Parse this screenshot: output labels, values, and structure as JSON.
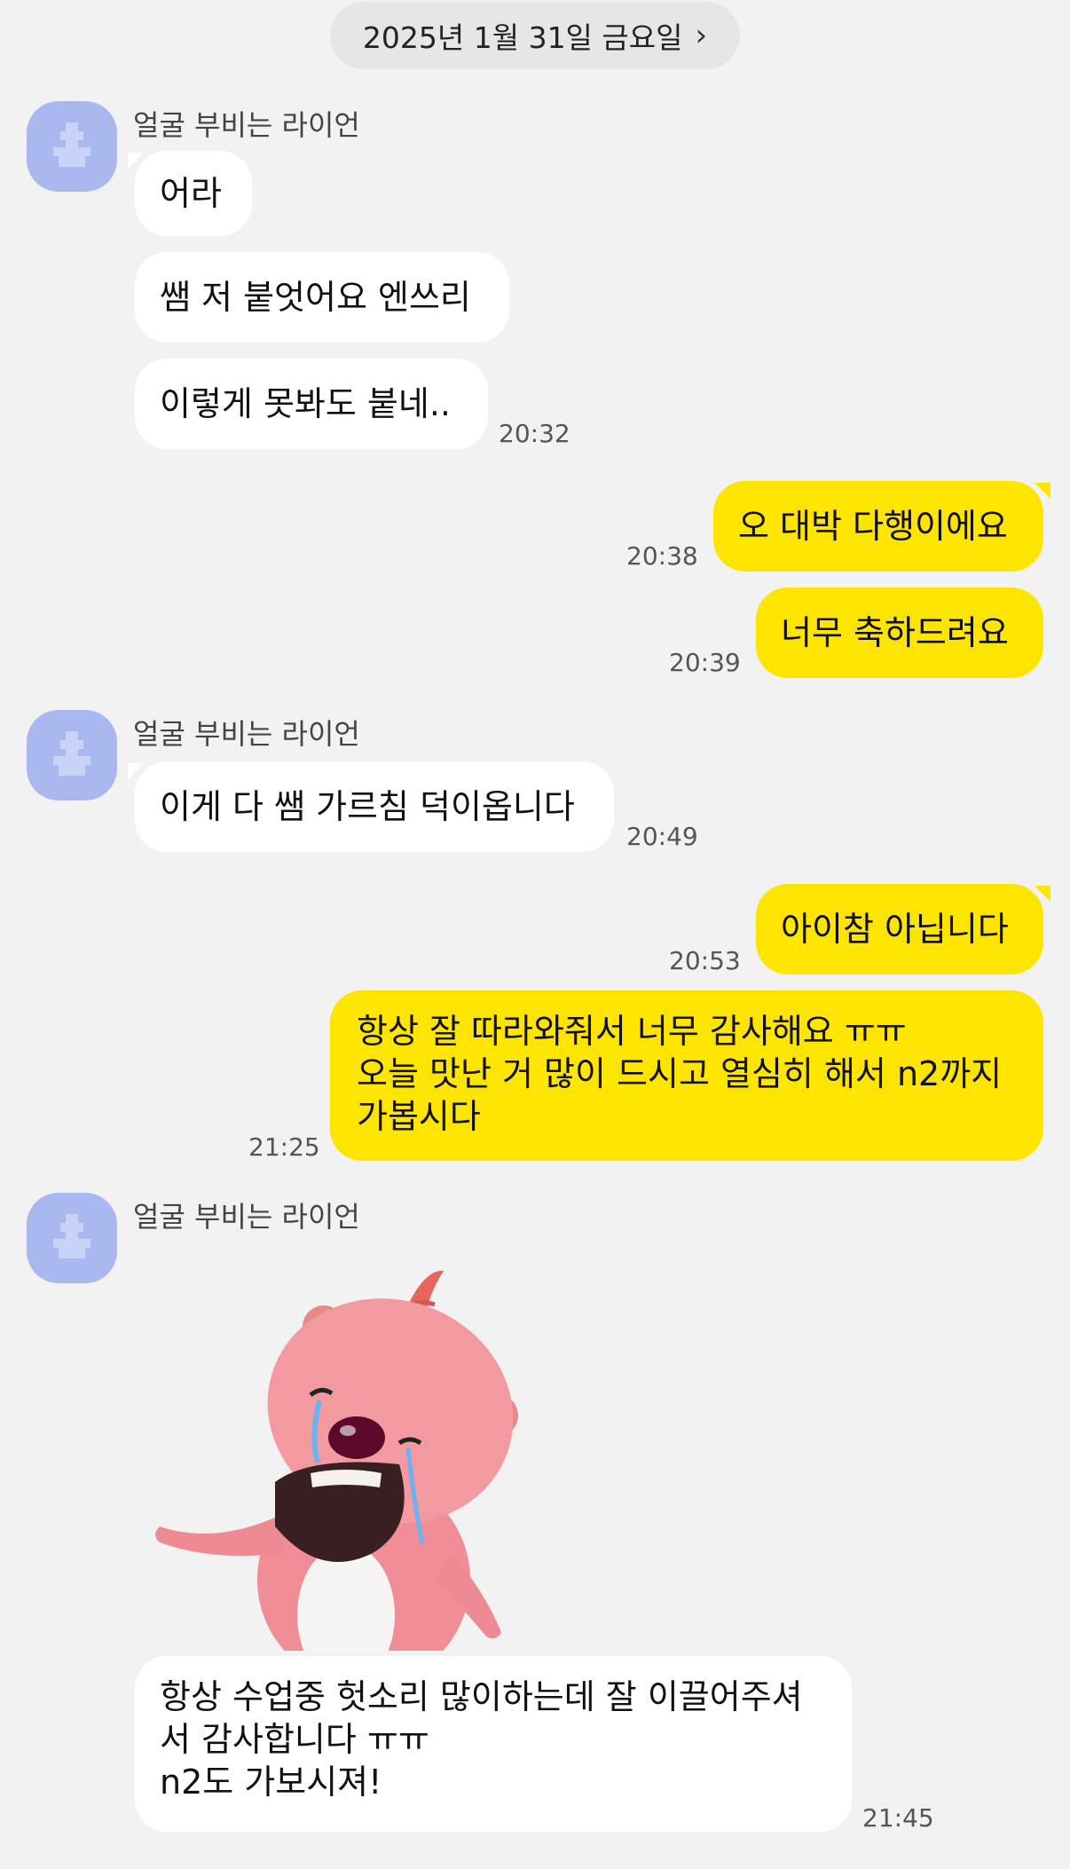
{
  "date_header": {
    "label": "2025년 1월 31일 금요일",
    "chevron": "›"
  },
  "sender_name": "얼굴 부비는 라이언",
  "messages": {
    "m1": "어라",
    "m2": "쌤 저 붙엇어요 엔쓰리",
    "m3": "이렇게 못봐도 붙네..",
    "m3_time": "20:32",
    "m4": "오 대박 다행이에요",
    "m4_time": "20:38",
    "m5": "너무 축하드려요",
    "m5_time": "20:39",
    "m6": "이게 다 쌤 가르침 덕이옵니다",
    "m6_time": "20:49",
    "m7": "아이참 아닙니다",
    "m7_time": "20:53",
    "m8_lines": [
      "항상 잘 따라와줘서 너무 감사해요 ㅠㅠ",
      "오늘 맛난 거 많이 드시고 열심히 해서 n2까지",
      "가봅시다"
    ],
    "m8_time": "21:25",
    "m9_lines": [
      "항상 수업중 헛소리 많이하는데 잘 이끌어주셔",
      "서 감사합니다 ㅠㅠ",
      "n2도 가보시져!"
    ],
    "m9_time": "21:45"
  },
  "colors": {
    "background": "#f2f2f2",
    "outgoing": "#fee500",
    "incoming": "#ffffff",
    "avatar": "#a9b9f0"
  },
  "icons": {
    "avatar": "default-profile-icon",
    "sticker": "crying-beaver-sticker"
  }
}
